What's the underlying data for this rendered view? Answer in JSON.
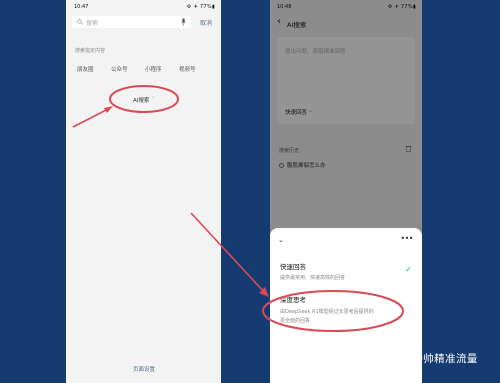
{
  "left_phone": {
    "status": {
      "time": "10:47",
      "icons": "⚙ ✈ 77%▮"
    },
    "search": {
      "placeholder": "搜索",
      "cancel_label": "取消"
    },
    "section_label": "搜索指定内容",
    "categories": [
      "朋友圈",
      "公众号",
      "小程序",
      "视频号"
    ],
    "ai_chip": {
      "label": "AI搜索",
      "arrow": "›"
    },
    "footer_link": "页面设置"
  },
  "right_phone": {
    "status": {
      "time": "10:48",
      "icons": "⚙ ✈ 77%▮"
    },
    "header": {
      "back": "‹",
      "title": "AI搜索"
    },
    "input": {
      "placeholder": "提出问题，获取精准回答",
      "mode_label": "快速回答",
      "mode_chevron": "⌄"
    },
    "history": {
      "label": "搜索历史",
      "item": "腹肌撕裂怎么办"
    },
    "sheet": {
      "collapse": "⌄",
      "more": "•••",
      "options": [
        {
          "title": "快速回答",
          "desc": [
            "提供最常用、快速高效的回答"
          ],
          "selected": true,
          "check": "✓"
        },
        {
          "title": "深度思考",
          "desc": [
            "由DeepSeek R1模型经过长思考后提供的",
            "更全面的回答"
          ],
          "selected": false
        }
      ]
    }
  },
  "watermark": {
    "text": "公众号 · 知乎 @杨帅精准流量"
  },
  "colors": {
    "background": "#163a72",
    "annotation": "#d94a55",
    "check": "#07c160",
    "link": "#586b95"
  }
}
